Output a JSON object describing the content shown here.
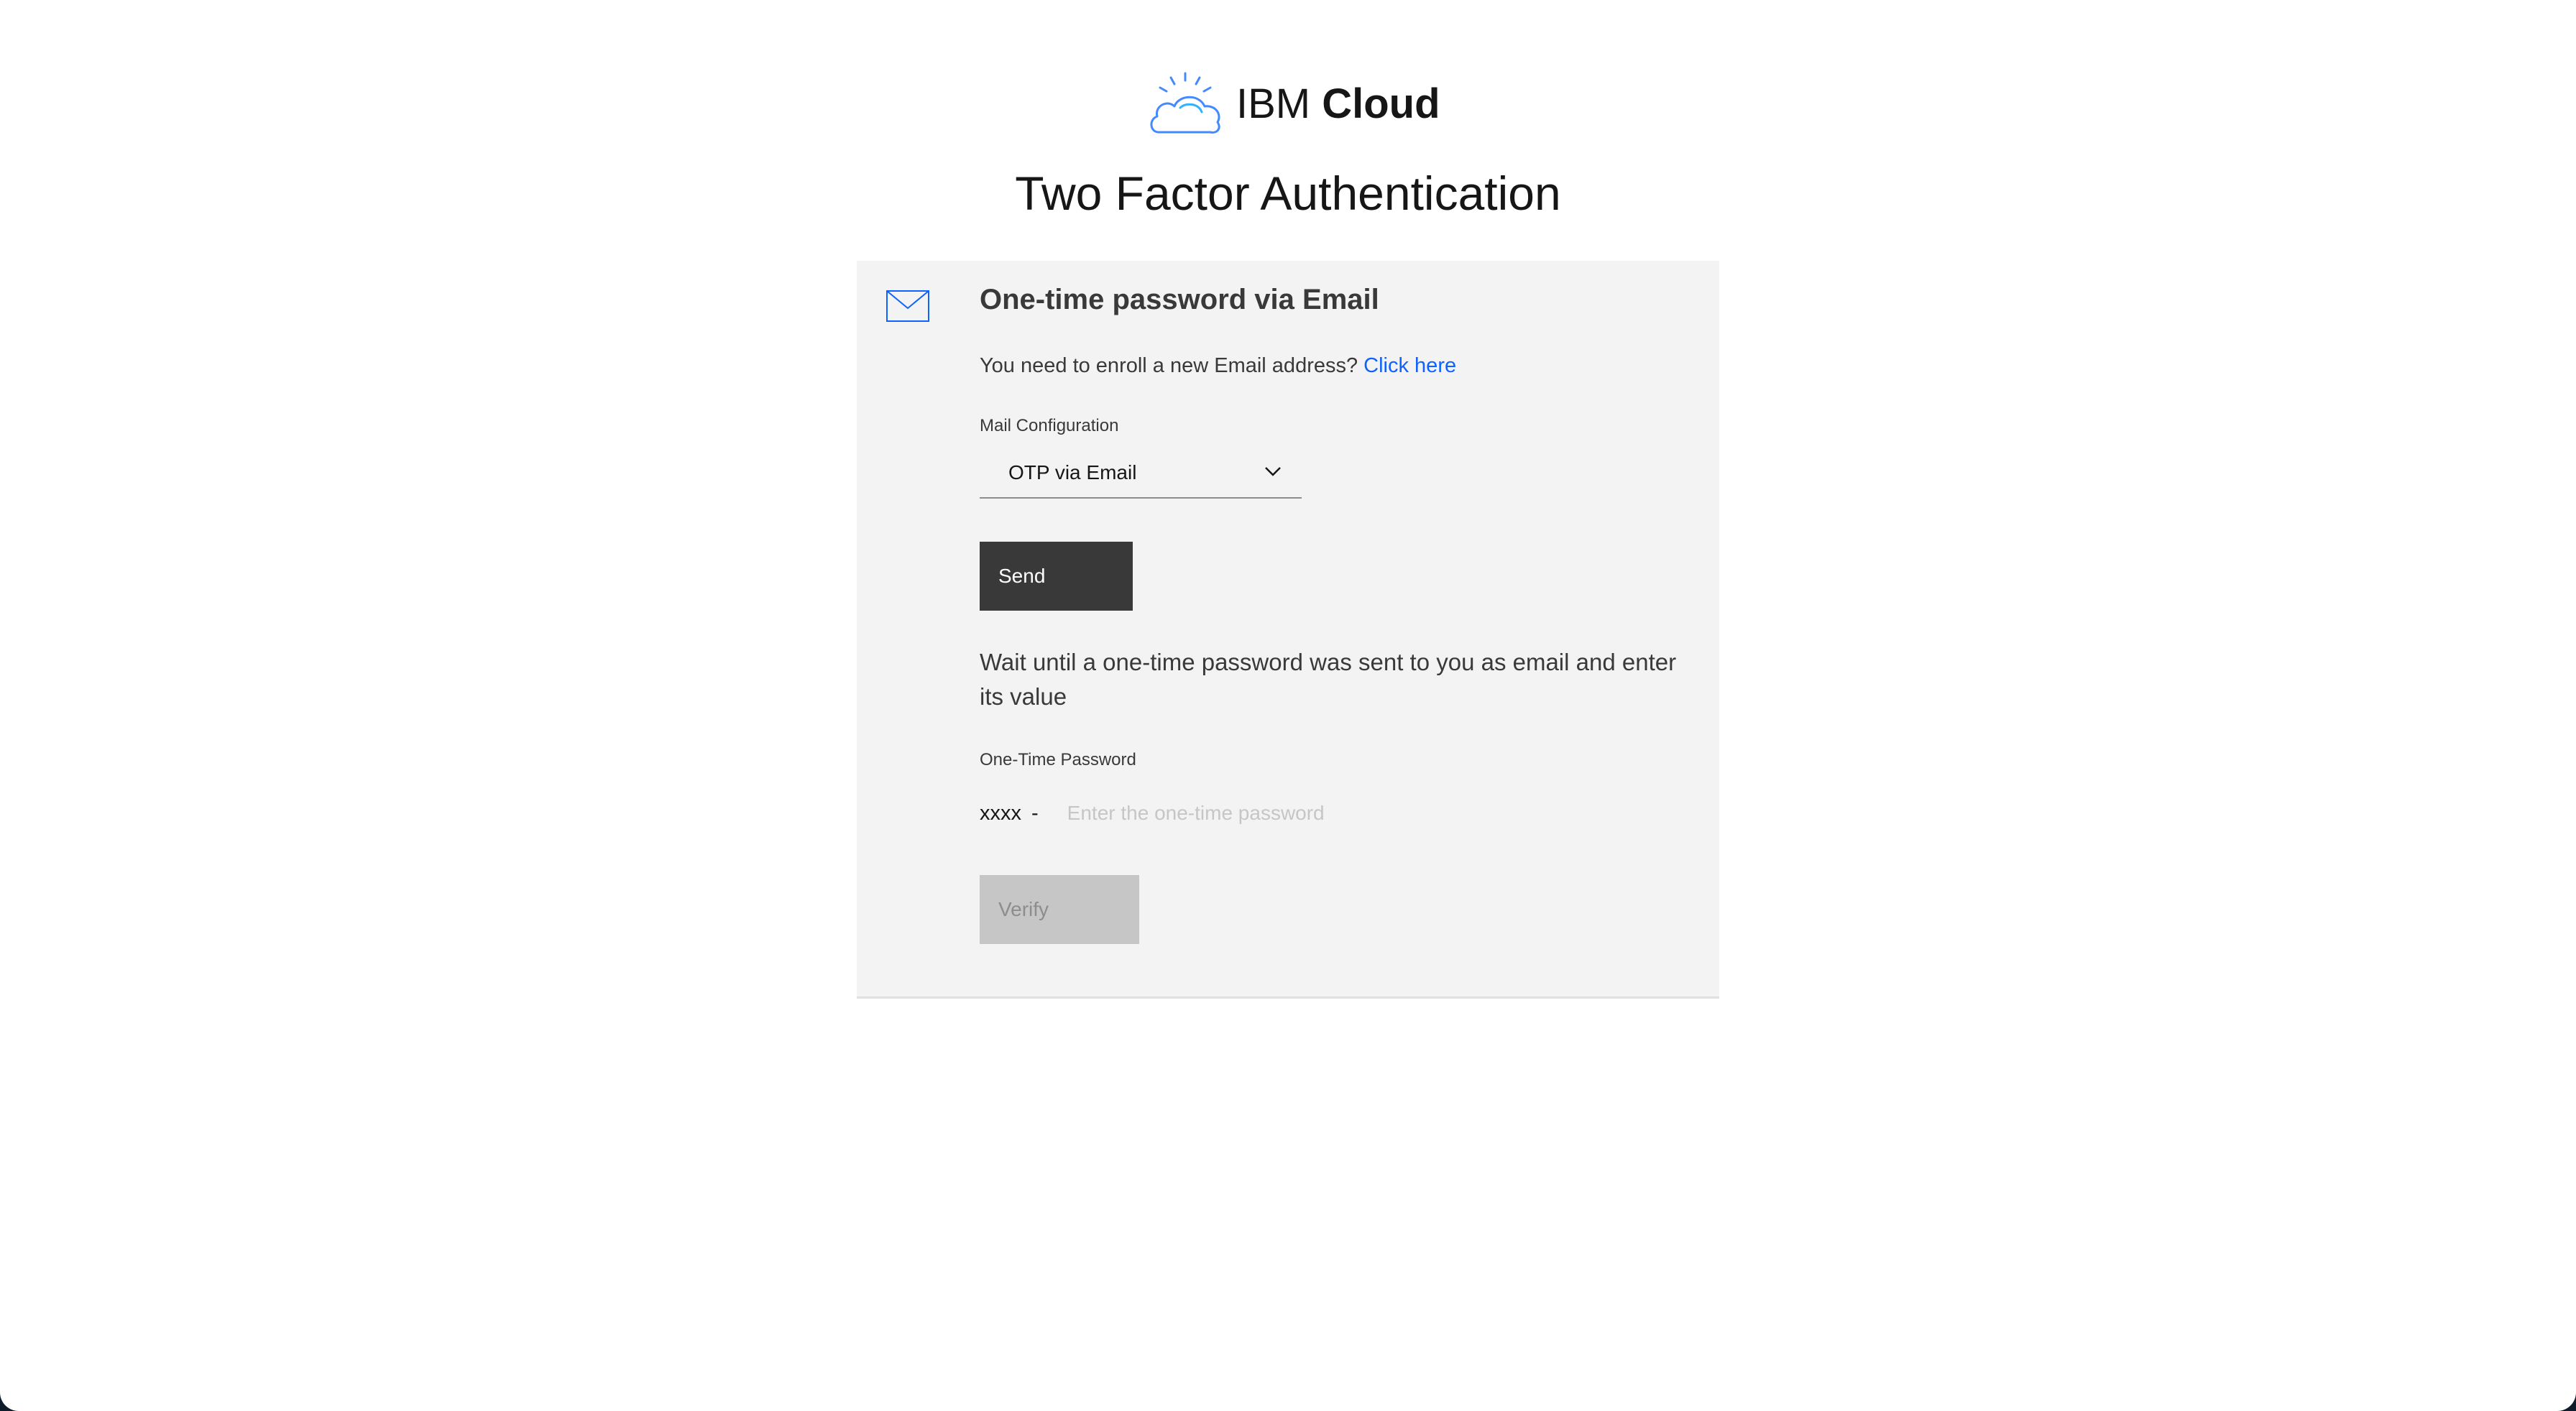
{
  "header": {
    "brand_light": "IBM",
    "brand_bold": "Cloud",
    "logo_icon": "ibm-cloud-logo",
    "title": "Two Factor Authentication"
  },
  "panel": {
    "icon": "mail-icon",
    "title": "One-time password via Email",
    "enroll_text": "You need to enroll a new Email address?",
    "enroll_link": "Click here",
    "mail_config_label": "Mail Configuration",
    "mail_config_value": "OTP via Email",
    "send_label": "Send",
    "wait_message": "Wait until a one-time password was sent to you as email and enter its value",
    "otp_label": "One-Time Password",
    "otp_prefix": "xxxx",
    "otp_separator": "-",
    "otp_placeholder": "Enter the one-time password",
    "otp_value": "",
    "verify_label": "Verify"
  },
  "colors": {
    "link": "#0f62fe",
    "panel_bg": "#f3f3f3",
    "send_bg": "#393939",
    "verify_disabled_bg": "#c6c6c6",
    "logo_blue": "#4589ff"
  }
}
